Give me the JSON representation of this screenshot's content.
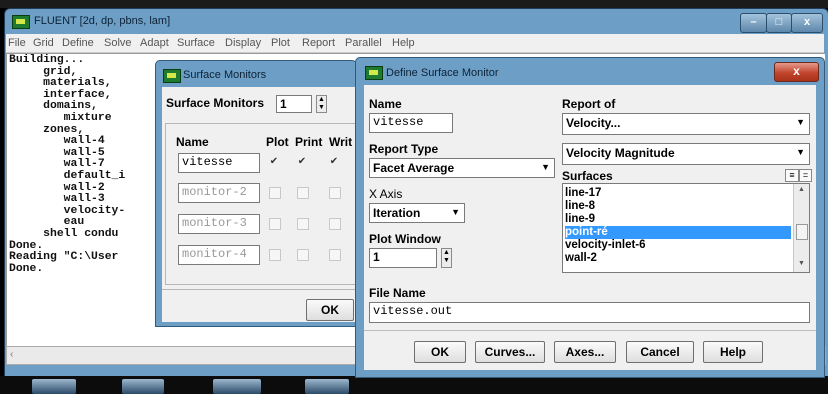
{
  "main_window": {
    "title": "FLUENT  [2d, dp, pbns, lam]",
    "menu": [
      "File",
      "Grid",
      "Define",
      "Solve",
      "Adapt",
      "Surface",
      "Display",
      "Plot",
      "Report",
      "Parallel",
      "Help"
    ],
    "console_lines": "Building...\n     grid,\n     materials,\n     interface,\n     domains,\n        mixture\n     zones,\n        wall-4\n        wall-5\n        wall-7\n        default_i\n        wall-2\n        wall-3\n        velocity-\n        eau\n     shell condu\nDone.\nReading \"C:\\User\nDone.",
    "scroll_left": "‹",
    "controls": {
      "minimize": "–",
      "maximize": "□",
      "close": "x"
    }
  },
  "surface_monitors": {
    "title": "Surface Monitors",
    "count_label": "Surface Monitors",
    "count_value": "1",
    "headers": {
      "name": "Name",
      "plot": "Plot",
      "print": "Print",
      "write": "Writ"
    },
    "rows": [
      {
        "name": "vitesse",
        "plot": true,
        "print": true,
        "write": true
      },
      {
        "name": "monitor-2",
        "plot": false,
        "print": false,
        "write": false
      },
      {
        "name": "monitor-3",
        "plot": false,
        "print": false,
        "write": false
      },
      {
        "name": "monitor-4",
        "plot": false,
        "print": false,
        "write": false
      }
    ],
    "ok_label": "OK"
  },
  "define_monitor": {
    "title": "Define Surface Monitor",
    "close": "x",
    "name_label": "Name",
    "name_value": "vitesse",
    "report_type_label": "Report Type",
    "report_type_value": "Facet Average",
    "x_axis_label": "X Axis",
    "x_axis_value": "Iteration",
    "plot_window_label": "Plot Window",
    "plot_window_value": "1",
    "report_of_label": "Report of",
    "report_of_value": "Velocity...",
    "report_sub_value": "Velocity Magnitude",
    "surfaces_label": "Surfaces",
    "surfaces": [
      "line-17",
      "line-8",
      "line-9",
      "point-ré",
      "velocity-inlet-6",
      "wall-2"
    ],
    "selected_surface": "point-ré",
    "file_name_label": "File Name",
    "file_name_value": "vitesse.out",
    "buttons": {
      "ok": "OK",
      "curves": "Curves...",
      "axes": "Axes...",
      "cancel": "Cancel",
      "help": "Help"
    }
  }
}
